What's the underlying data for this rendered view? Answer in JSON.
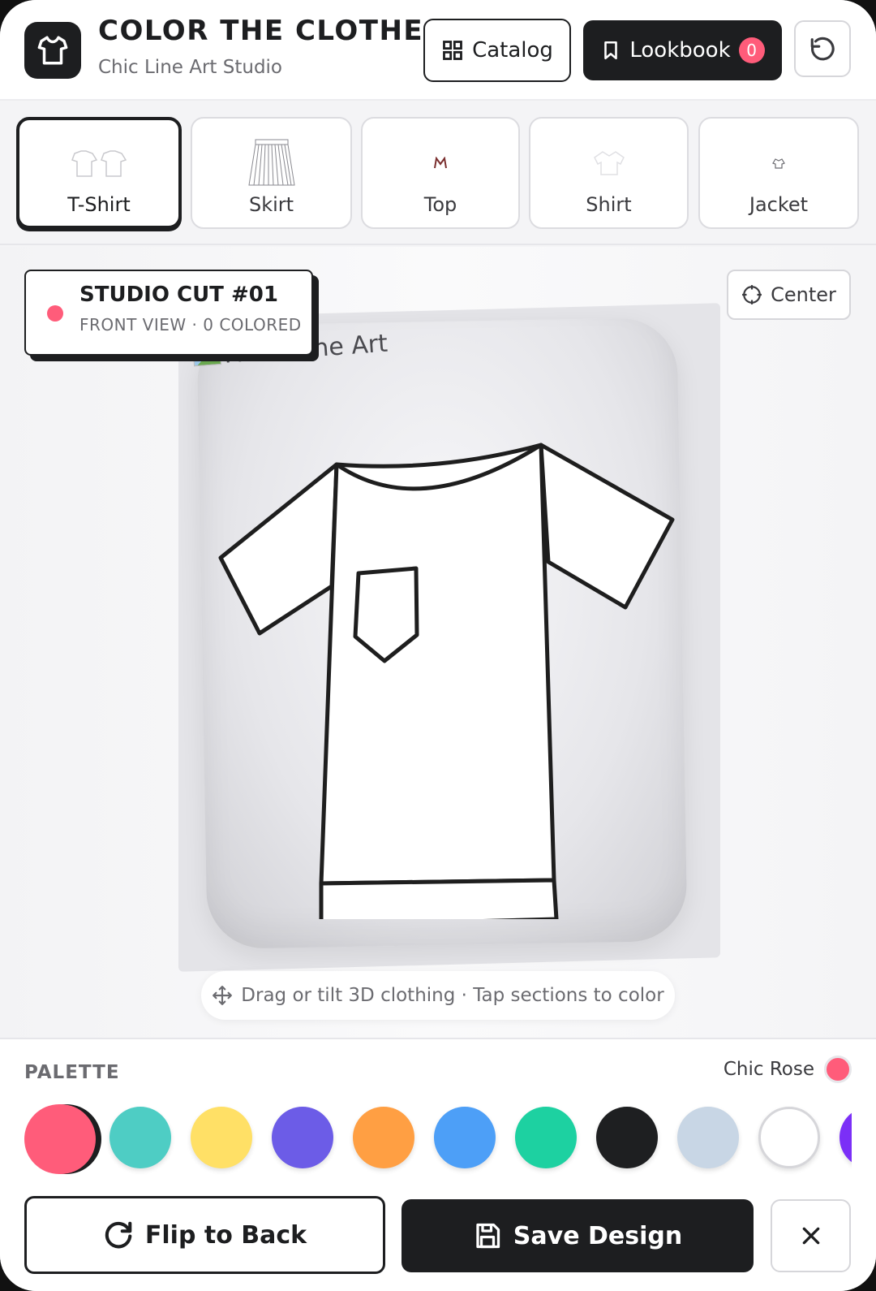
{
  "header": {
    "title": "COLOR THE CLOTHES",
    "subtitle": "Chic Line Art Studio",
    "catalog_label": "Catalog",
    "lookbook_label": "Lookbook",
    "lookbook_count": "0"
  },
  "tabs": [
    {
      "label": "T-Shirt",
      "active": true
    },
    {
      "label": "Skirt",
      "active": false
    },
    {
      "label": "Top",
      "active": false
    },
    {
      "label": "Shirt",
      "active": false
    },
    {
      "label": "Jacket",
      "active": false
    }
  ],
  "canvas": {
    "card_title": "STUDIO CUT #01",
    "card_subtitle": "FRONT VIEW · 0 COLORED",
    "center_label": "Center",
    "image_alt": "Front Line Art",
    "hint": "Drag or tilt 3D clothing · Tap sections to color"
  },
  "palette": {
    "label": "PALETTE",
    "current_name": "Chic Rose",
    "current_color": "#ff5c7a",
    "colors": [
      "#ff5c7a",
      "#4ecdc4",
      "#ffe066",
      "#6c5ce7",
      "#ff9f43",
      "#4d9ff7",
      "#1dd1a1",
      "#1e1f21",
      "#c8d6e5",
      "#ffffff",
      "#7b2ff7"
    ]
  },
  "actions": {
    "flip_label": "Flip to Back",
    "save_label": "Save Design"
  }
}
